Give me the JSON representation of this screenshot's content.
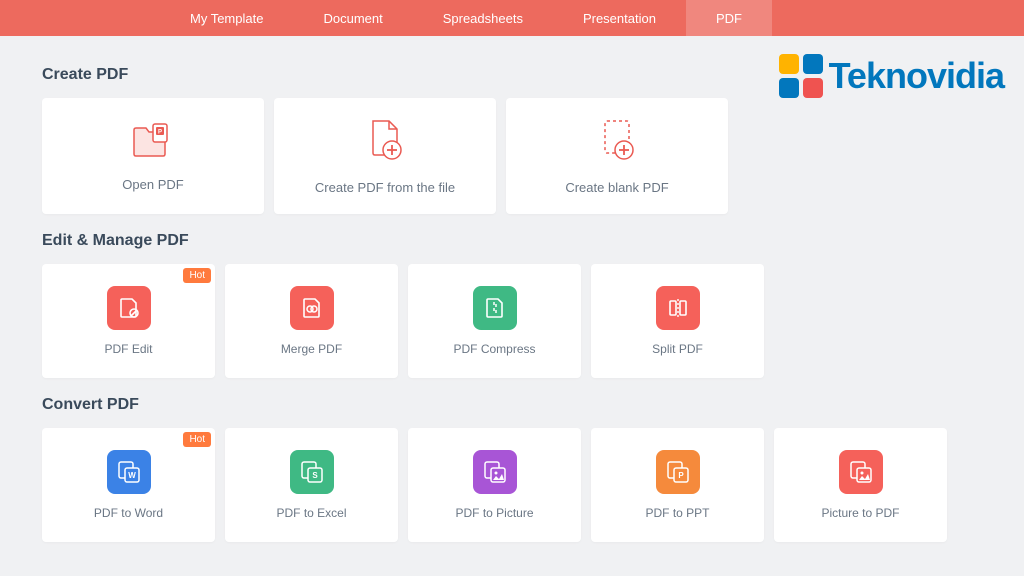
{
  "colors": {
    "accent": "#ed6a5e",
    "badge": "#ff7a3d",
    "red": "#f5615a",
    "green": "#3fb984",
    "blue": "#3b82e6",
    "purple": "#a855d6",
    "orange": "#f58a3c"
  },
  "tabs": [
    {
      "label": "My Template"
    },
    {
      "label": "Document"
    },
    {
      "label": "Spreadsheets"
    },
    {
      "label": "Presentation"
    },
    {
      "label": "PDF",
      "active": true
    }
  ],
  "watermark": {
    "text": "Teknovidia"
  },
  "sections": {
    "create": {
      "title": "Create PDF",
      "items": [
        {
          "label": "Open PDF"
        },
        {
          "label": "Create PDF from the file"
        },
        {
          "label": "Create blank PDF"
        }
      ]
    },
    "edit": {
      "title": "Edit & Manage PDF",
      "badge": "Hot",
      "items": [
        {
          "label": "PDF Edit"
        },
        {
          "label": "Merge PDF"
        },
        {
          "label": "PDF Compress"
        },
        {
          "label": "Split PDF"
        }
      ]
    },
    "convert": {
      "title": "Convert PDF",
      "badge": "Hot",
      "items": [
        {
          "label": "PDF to Word"
        },
        {
          "label": "PDF to Excel"
        },
        {
          "label": "PDF to Picture"
        },
        {
          "label": "PDF to PPT"
        },
        {
          "label": "Picture to PDF"
        }
      ]
    }
  }
}
